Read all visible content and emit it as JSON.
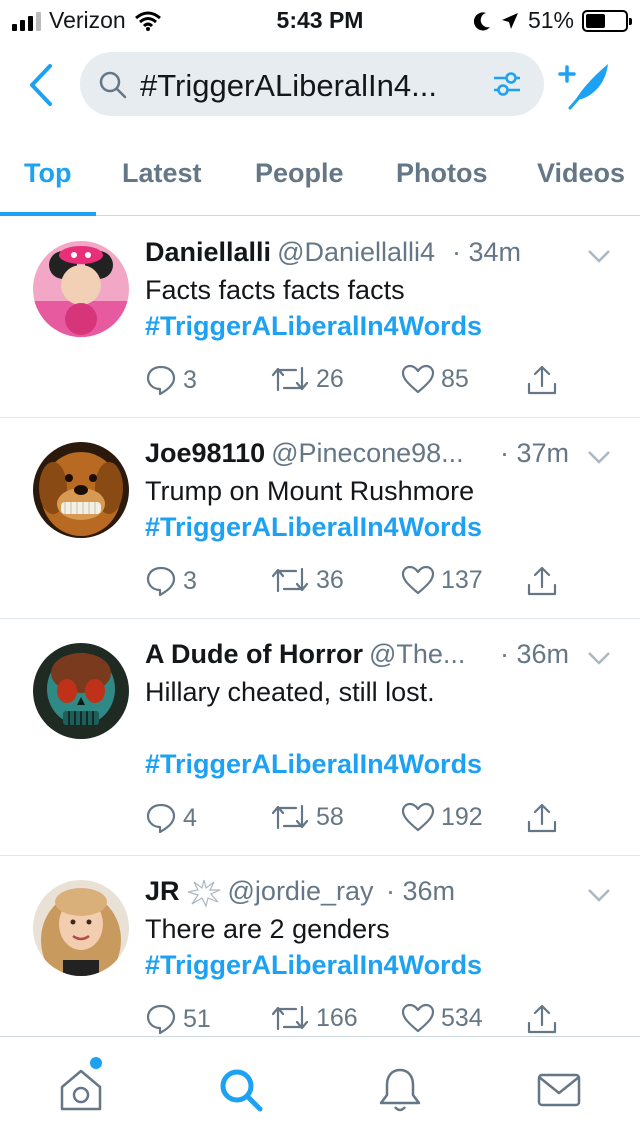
{
  "status": {
    "carrier": "Verizon",
    "time": "5:43 PM",
    "battery": "51%",
    "battery_level": 0.51
  },
  "search": {
    "query": "#TriggerALiberalIn4..."
  },
  "tabs": [
    {
      "label": "Top"
    },
    {
      "label": "Latest"
    },
    {
      "label": "People"
    },
    {
      "label": "Photos"
    },
    {
      "label": "Videos"
    }
  ],
  "tweets": [
    {
      "name": "Daniellalli",
      "handle": "@Daniellalli4",
      "time": "· 34m",
      "text": "Facts facts facts facts",
      "hashtag": "#TriggerALiberalIn4Words",
      "replies": "3",
      "retweets": "26",
      "likes": "85"
    },
    {
      "name": "Joe98110",
      "handle": "@Pinecone98...",
      "time": "· 37m",
      "text": "Trump on Mount Rushmore",
      "hashtag": "#TriggerALiberalIn4Words",
      "replies": "3",
      "retweets": "36",
      "likes": "137"
    },
    {
      "name": "A Dude of Horror",
      "handle": "@The...",
      "time": "· 36m",
      "text": "Hillary cheated, still lost.",
      "hashtag": "#TriggerALiberalIn4Words",
      "replies": "4",
      "retweets": "58",
      "likes": "192"
    },
    {
      "name": "JR",
      "handle": "@jordie_ray",
      "time": "· 36m",
      "text": "There are 2 genders",
      "hashtag": "#TriggerALiberalIn4Words",
      "replies": "51",
      "retweets": "166",
      "likes": "534"
    }
  ],
  "icons": {
    "back": "chevron-left-icon",
    "search": "search-icon",
    "filter": "filter-sliders-icon",
    "compose": "compose-tweet-icon",
    "reply": "reply-icon",
    "retweet": "retweet-icon",
    "like": "heart-icon",
    "share": "share-icon",
    "home": "home-icon",
    "explore": "search-icon",
    "notifications": "bell-icon",
    "messages": "mail-icon"
  },
  "colors": {
    "accent": "#1da1f2",
    "muted": "#657786",
    "text": "#14171a",
    "divider": "#e1e8ed"
  }
}
